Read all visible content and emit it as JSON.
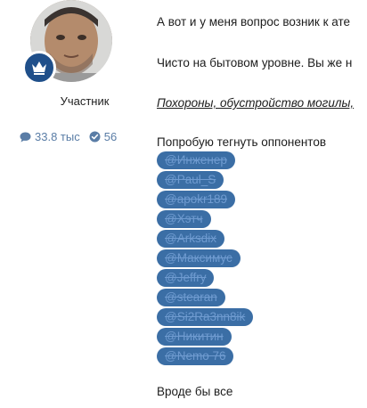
{
  "user": {
    "title": "Участник",
    "messages_count": "33.8 тыс",
    "reactions_count": "56",
    "rank_color": "#1f4f8a"
  },
  "post": {
    "line1": "А вот и у меня вопрос возник к ате",
    "line2": "Чисто на бытовом уровне. Вы же н",
    "line3_link": "Похороны, обустройство могилы,",
    "tag_intro": "Попробую тегнуть оппонентов",
    "mentions": [
      "@Инженер",
      "@Paul_S",
      "@apokr189",
      "@Хэтч",
      "@Arksdix",
      "@Максимус",
      "@Jeffry",
      "@stearan",
      "@Si2Ra3nn8ik",
      "@Никитин",
      "@Nemo 76"
    ],
    "closing": "Вроде бы все"
  },
  "icons": {
    "messages": "speech-bubble-icon",
    "reactions": "check-circle-icon",
    "rank": "crown-icon"
  },
  "colors": {
    "mention_bg": "#3b6ea5",
    "stat_text": "#5a7da6"
  }
}
